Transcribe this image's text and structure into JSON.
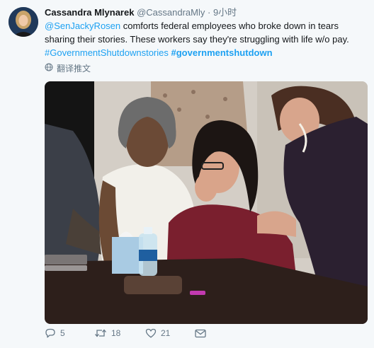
{
  "tweet": {
    "author_name": "Cassandra Mlynarek",
    "author_handle": "@CassandraMly",
    "separator": "·",
    "time": "9小时",
    "mention": "@SenJackyRosen",
    "text": " comforts federal employees who broke down in tears sharing their stories. These workers say they're struggling with life w/o pay.",
    "hashtag1": "#GovernmentShutdownstories",
    "hashtag2": "#governmentshutdown",
    "translate_label": "翻译推文"
  },
  "actions": {
    "reply_count": "5",
    "retweet_count": "18",
    "like_count": "21"
  },
  "icons": {
    "translate": "globe-icon",
    "reply": "reply-icon",
    "retweet": "retweet-icon",
    "like": "heart-icon",
    "message": "direct-message-icon"
  },
  "colors": {
    "link": "#1da1f2",
    "muted": "#657786",
    "text": "#14171a",
    "background": "#f5f8fa"
  }
}
